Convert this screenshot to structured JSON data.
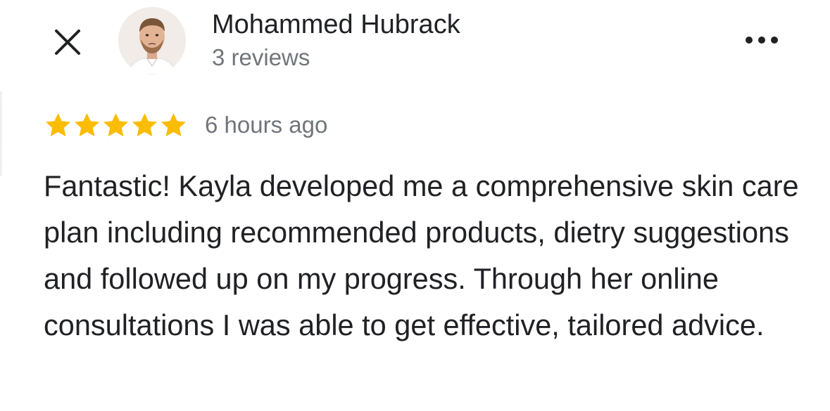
{
  "review": {
    "reviewer_name": "Mohammed Hubrack",
    "reviewer_reviews": "3 reviews",
    "rating": 5,
    "rating_max": 5,
    "time": "6 hours ago",
    "text": "Fantastic! Kayla developed me a comprehensive skin care plan including recommended products, dietry suggestions and followed up on my progress. Through her online consultations I was able to get effective, tailored advice."
  },
  "icons": {
    "close": "close-icon",
    "more": "more-options-icon",
    "star": "star-icon"
  },
  "colors": {
    "star": "#fbbc04",
    "primary_text": "#202124",
    "secondary_text": "#70757a"
  }
}
